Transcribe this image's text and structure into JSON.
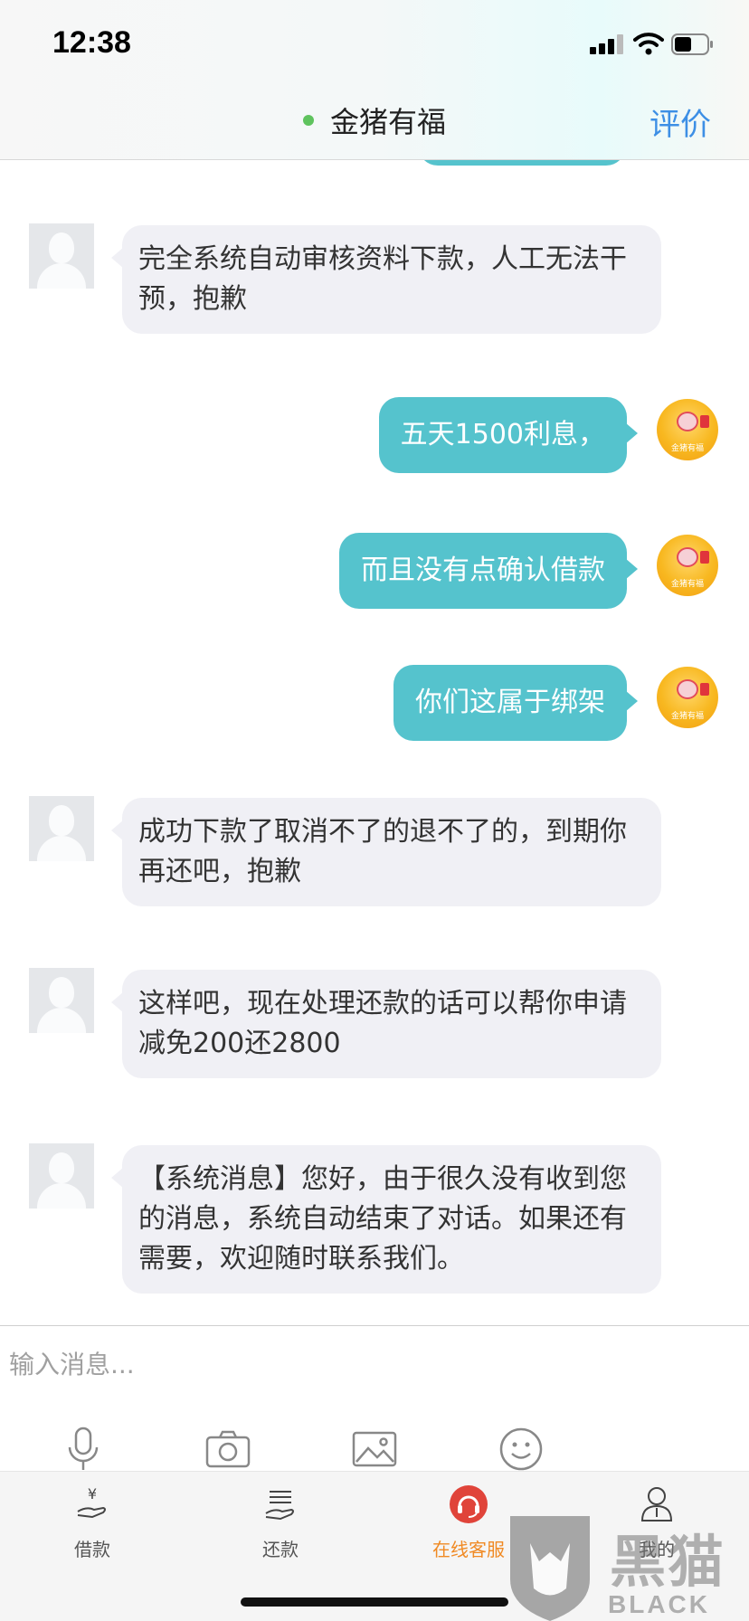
{
  "status_bar": {
    "time": "12:38"
  },
  "header": {
    "title": "金猪有福",
    "rate_label": "评价"
  },
  "messages": [
    {
      "side": "left",
      "text": "完全系统自动审核资料下款，人工无法干预，抱歉"
    },
    {
      "side": "right",
      "text": "五天1500利息，"
    },
    {
      "side": "right",
      "text": "而且没有点确认借款"
    },
    {
      "side": "right",
      "text": "你们这属于绑架"
    },
    {
      "side": "left",
      "text": "成功下款了取消不了的退不了的，到期你再还吧，抱歉"
    },
    {
      "side": "left",
      "text": "这样吧，现在处理还款的话可以帮你申请减免200还2800"
    },
    {
      "side": "left",
      "text": "【系统消息】您好，由于很久没有收到您的消息，系统自动结束了对话。如果还有需要，欢迎随时联系我们。"
    }
  ],
  "avatar_caption": "金猪有福",
  "input": {
    "placeholder": "输入消息..."
  },
  "toolbar": {
    "icons": [
      "microphone-icon",
      "camera-icon",
      "image-icon",
      "emoji-icon"
    ]
  },
  "tabs": [
    {
      "label": "借款",
      "icon": "loan-icon"
    },
    {
      "label": "还款",
      "icon": "repay-icon"
    },
    {
      "label": "在线客服",
      "icon": "headset-icon",
      "active": true
    },
    {
      "label": "我的",
      "icon": "profile-icon"
    }
  ],
  "watermark": {
    "text": "黑猫",
    "text_en": "BLACK CAT"
  },
  "colors": {
    "user_bubble": "#55c3cd",
    "agent_bubble": "#f0f0f5",
    "accent": "#3d8fe5",
    "active_tab": "#f08a24",
    "online": "#5ec35e"
  }
}
